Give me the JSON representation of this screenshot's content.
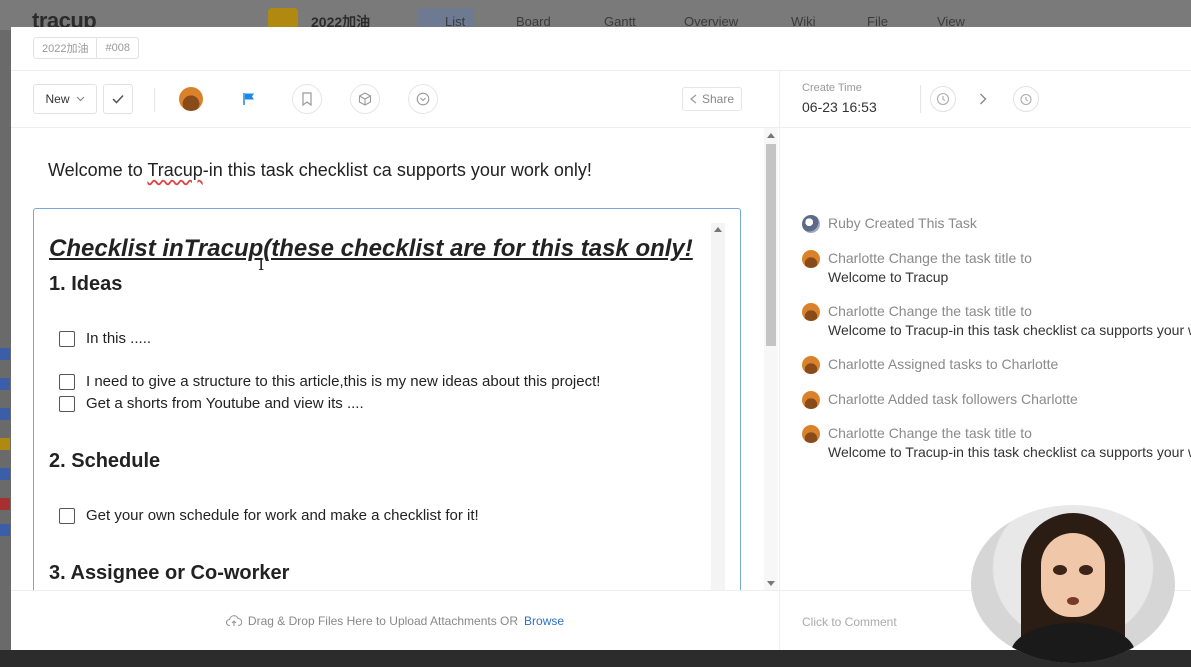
{
  "background": {
    "logo": "tracup",
    "project_name": "2022加油",
    "nav_tabs": [
      "List",
      "Board",
      "Gantt",
      "Overview",
      "Wiki",
      "File",
      "View"
    ]
  },
  "modal": {
    "breadcrumb": {
      "project": "2022加油",
      "task_id": "#008"
    },
    "toolbar": {
      "status_label": "New",
      "share_label": "Share",
      "icons": [
        "check-icon",
        "assignee-avatar",
        "flag-icon",
        "bookmark-icon",
        "cube-icon",
        "download-circle-icon"
      ]
    },
    "create_time": {
      "label": "Create Time",
      "value": "06-23 16:53"
    },
    "task_title": {
      "prefix": "Welcome to ",
      "underlined": "Tracup",
      "suffix": "-in this task checklist ca supports your work only!"
    },
    "checklist": {
      "title": "Checklist inTracup(these checklist are for this task only!",
      "sections": [
        {
          "heading": "1. Ideas",
          "items": [
            "In this .....",
            "I need to give a structure to this article,this is my new ideas about this project!",
            "Get a shorts from Youtube and view its ...."
          ]
        },
        {
          "heading": "2. Schedule",
          "items": [
            "Get your own schedule for work and make a checklist for it!"
          ]
        },
        {
          "heading": "3. Assignee or Co-worker",
          "items": []
        }
      ]
    },
    "upload": {
      "text": "Drag & Drop Files Here to Upload Attachments OR",
      "browse": "Browse"
    },
    "activity": [
      {
        "head": "Ruby Created This Task",
        "body": ""
      },
      {
        "head": "Charlotte Change the task title to",
        "body": "Welcome to Tracup"
      },
      {
        "head": "Charlotte Change the task title to",
        "body": "Welcome to Tracup-in this task checklist ca supports your wo"
      },
      {
        "head": "Charlotte Assigned tasks to Charlotte",
        "body": ""
      },
      {
        "head": "Charlotte Added task followers Charlotte",
        "body": ""
      },
      {
        "head": "Charlotte Change the task title to",
        "body": "Welcome to Tracup-in this task checklist ca supports your wo"
      }
    ],
    "comment_placeholder": "Click to Comment"
  },
  "colors": {
    "accent": "#2e6fc7",
    "flag": "#1e88e5",
    "editor_border": "#7aa7d9",
    "avatar": "#d9822b"
  }
}
